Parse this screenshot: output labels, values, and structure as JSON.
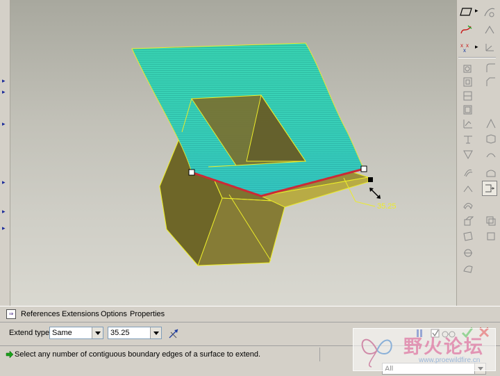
{
  "dashboard": {
    "tabs": {
      "references": "References",
      "extensions": "Extensions",
      "options": "Options",
      "properties": "Properties"
    },
    "extend_type_label": "Extend type",
    "extend_type_value": "Same",
    "distance_value": "35.25",
    "status_message": "Select any number of contiguous boundary edges of a surface to extend.",
    "filter_value": "All"
  },
  "viewport": {
    "dimension_label": "35.25"
  },
  "watermark": {
    "chinese_text": "野火论坛",
    "url_text": "www.proewildfire.cn"
  },
  "colors": {
    "surface": "#35d0b0",
    "solid": "#7c7230",
    "edge_highlight": "#cc2a35",
    "outline": "#ecec2a",
    "accept": "#1aa01a",
    "cancel": "#cc1a1a",
    "pause": "#1a3aa0"
  },
  "icons": [
    "datum-plane-icon",
    "sketch-icon",
    "axis-icon",
    "hole-icon",
    "shell-icon",
    "rib-icon",
    "draft-icon",
    "round-icon",
    "chamfer-icon",
    "pattern-icon",
    "mirror-icon",
    "extend-icon",
    "merge-icon",
    "trim-icon",
    "offset-icon",
    "thicken-icon",
    "solidify-icon",
    "warp-icon",
    "pause-icon",
    "preview-icon",
    "glasses-icon",
    "accept-icon",
    "cancel-icon"
  ]
}
